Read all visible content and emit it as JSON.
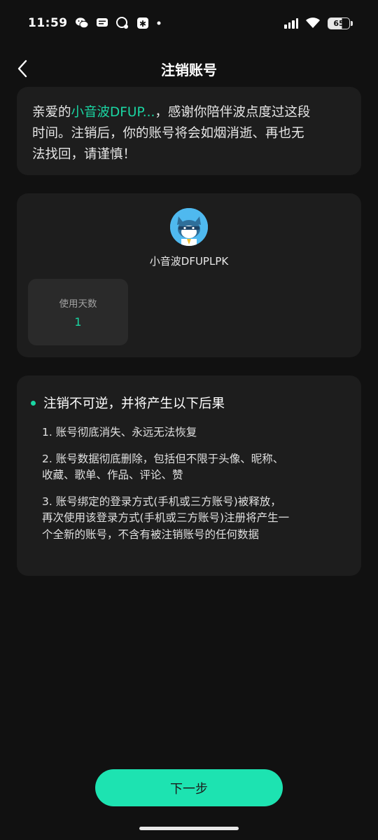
{
  "status_bar": {
    "time": "11:59",
    "battery": "65",
    "left_icons": [
      "wechat-icon",
      "message-icon",
      "chat-icon",
      "app-icon",
      "dot-icon"
    ]
  },
  "nav": {
    "title": "注销账号"
  },
  "intro": {
    "prefix": "亲爱的",
    "nickname": "小音波DFUP...",
    "suffix": "，感谢你陪伴波点度过这段时间。注销后，你的账号将会如烟消逝、再也无法找回，请谨慎！"
  },
  "profile": {
    "name": "小音波DFUPLPK",
    "stats": [
      {
        "label": "使用天数",
        "value": "1"
      }
    ]
  },
  "warning": {
    "title": "注销不可逆，并将产生以下后果",
    "items": [
      "1. 账号彻底消失、永远无法恢复",
      "2. 账号数据彻底删除，包括但不限于头像、昵称、收藏、歌单、作品、评论、赞",
      "3. 账号绑定的登录方式(手机或三方账号)被释放，再次使用该登录方式(手机或三方账号)注册将产生一个全新的账号，不含有被注销账号的任何数据"
    ]
  },
  "footer": {
    "next_label": "下一步"
  },
  "colors": {
    "accent": "#1de3b1",
    "nickname": "#1ad6a3",
    "background": "#111111",
    "card": "#1d1d1d"
  }
}
